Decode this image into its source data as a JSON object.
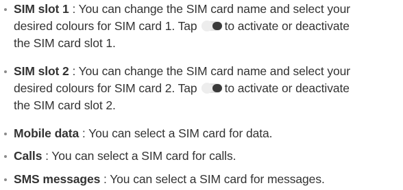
{
  "items": [
    {
      "term": "SIM slot 1",
      "line1": " : You can change the SIM card name and select your",
      "line2a": "desired colours for SIM card 1. Tap",
      "line2b": "to activate or deactivate",
      "line3": "the SIM card slot 1.",
      "toggle_icon": "toggle-switch-icon"
    },
    {
      "term": "SIM slot 2",
      "line1": " : You can change the SIM card name and select your",
      "line2a": "desired colours for SIM card 2. Tap",
      "line2b": "to activate or deactivate",
      "line3": "the SIM card slot 2.",
      "toggle_icon": "toggle-switch-icon"
    },
    {
      "term": "Mobile data",
      "desc": " : You can select a SIM card for data."
    },
    {
      "term": "Calls",
      "desc": " : You can select a SIM card for calls."
    },
    {
      "term": "SMS messages",
      "desc": " : You can select a SIM card for messages."
    }
  ],
  "colors": {
    "text": "#333333",
    "bullet": "#8a8a8a",
    "toggle_track": "#e2e2e2",
    "toggle_knob": "#3a3a3a"
  }
}
